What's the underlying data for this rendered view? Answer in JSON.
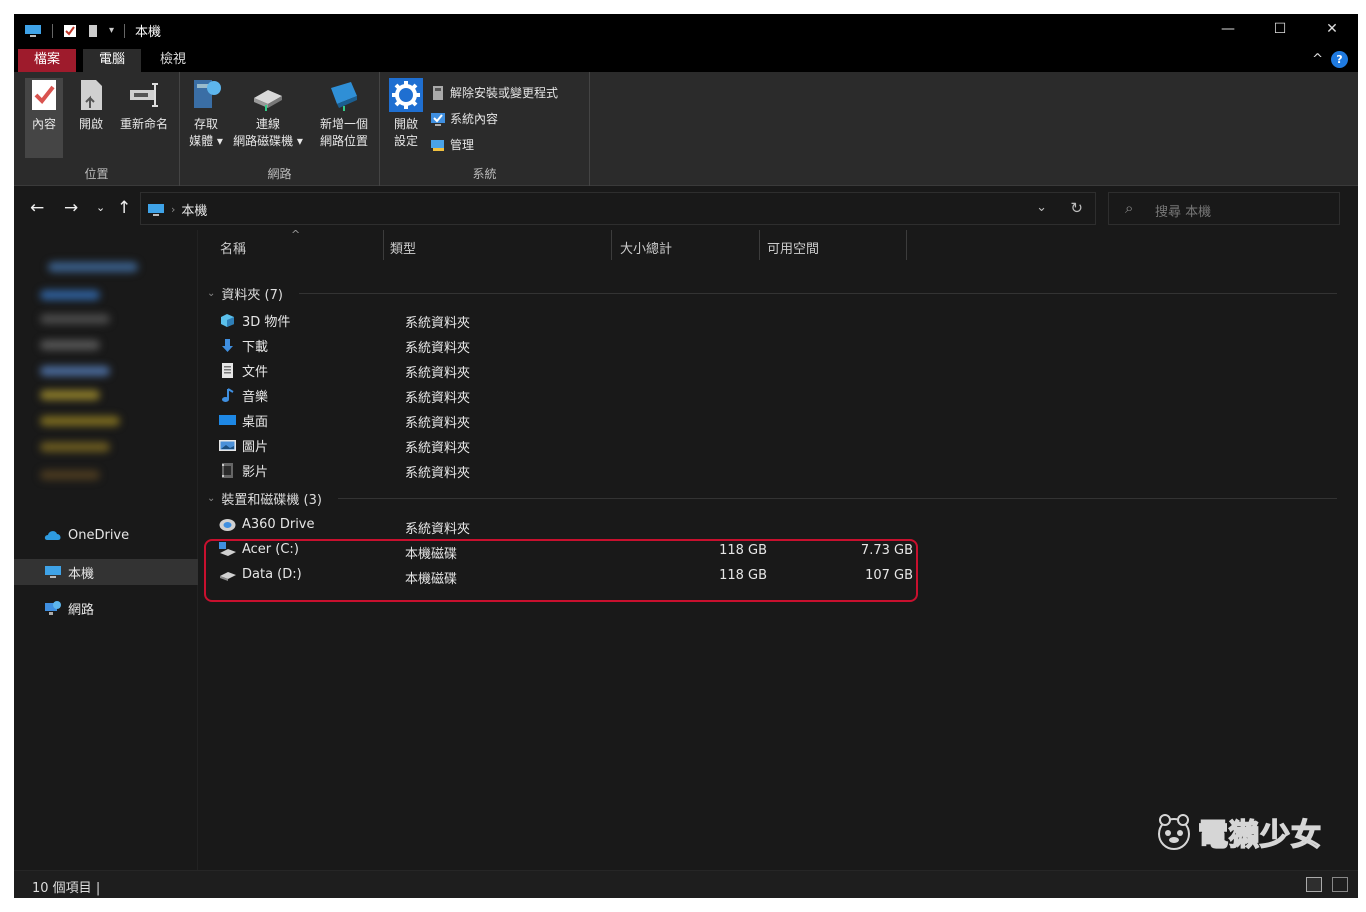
{
  "window": {
    "title": "本機",
    "controls": {
      "minimize": "—",
      "maximize": "☐",
      "close": "✕"
    }
  },
  "tabs": {
    "file": "檔案",
    "computer": "電腦",
    "view": "檢視",
    "help": "?",
    "collapse": "^"
  },
  "ribbon": {
    "location": {
      "label": "位置",
      "properties": "內容",
      "open": "開啟",
      "rename": "重新命名"
    },
    "network": {
      "label": "網路",
      "access_media": [
        "存取",
        "媒體 ▾"
      ],
      "map_drive": [
        "連線",
        "網路磁碟機 ▾"
      ],
      "add_location": [
        "新增一個",
        "網路位置"
      ]
    },
    "system": {
      "label": "系統",
      "open_settings": [
        "開啟",
        "設定"
      ],
      "uninstall": "解除安裝或變更程式",
      "system_properties": "系統內容",
      "manage": "管理"
    }
  },
  "address": {
    "crumb": "本機",
    "search_placeholder": "搜尋 本機"
  },
  "navpane": {
    "onedrive": "OneDrive",
    "this_pc": "本機",
    "network": "網路"
  },
  "columns": {
    "name": "名稱",
    "type": "類型",
    "total": "大小總計",
    "free": "可用空間"
  },
  "groups": {
    "folders": "資料夾 (7)",
    "devices": "裝置和磁碟機 (3)"
  },
  "folders": [
    {
      "name": "3D 物件",
      "type": "系統資料夾",
      "icon": "3d-objects-icon"
    },
    {
      "name": "下載",
      "type": "系統資料夾",
      "icon": "download-icon"
    },
    {
      "name": "文件",
      "type": "系統資料夾",
      "icon": "document-icon"
    },
    {
      "name": "音樂",
      "type": "系統資料夾",
      "icon": "music-icon"
    },
    {
      "name": "桌面",
      "type": "系統資料夾",
      "icon": "desktop-icon"
    },
    {
      "name": "圖片",
      "type": "系統資料夾",
      "icon": "pictures-icon"
    },
    {
      "name": "影片",
      "type": "系統資料夾",
      "icon": "video-icon"
    }
  ],
  "devices": [
    {
      "name": "A360 Drive",
      "type": "系統資料夾",
      "total": "",
      "free": "",
      "icon": "cloud-drive-icon"
    },
    {
      "name": "Acer (C:)",
      "type": "本機磁碟",
      "total": "118 GB",
      "free": "7.73 GB",
      "icon": "system-drive-icon"
    },
    {
      "name": "Data (D:)",
      "type": "本機磁碟",
      "total": "118 GB",
      "free": "107 GB",
      "icon": "drive-icon"
    }
  ],
  "status": {
    "count": "10 個項目",
    "cursor": "|"
  },
  "watermark": "電獺少女",
  "colors": {
    "accent": "#1f7ae0",
    "file_tab": "#9e1b2c",
    "highlight": "#c8102e",
    "background": "#191919"
  }
}
